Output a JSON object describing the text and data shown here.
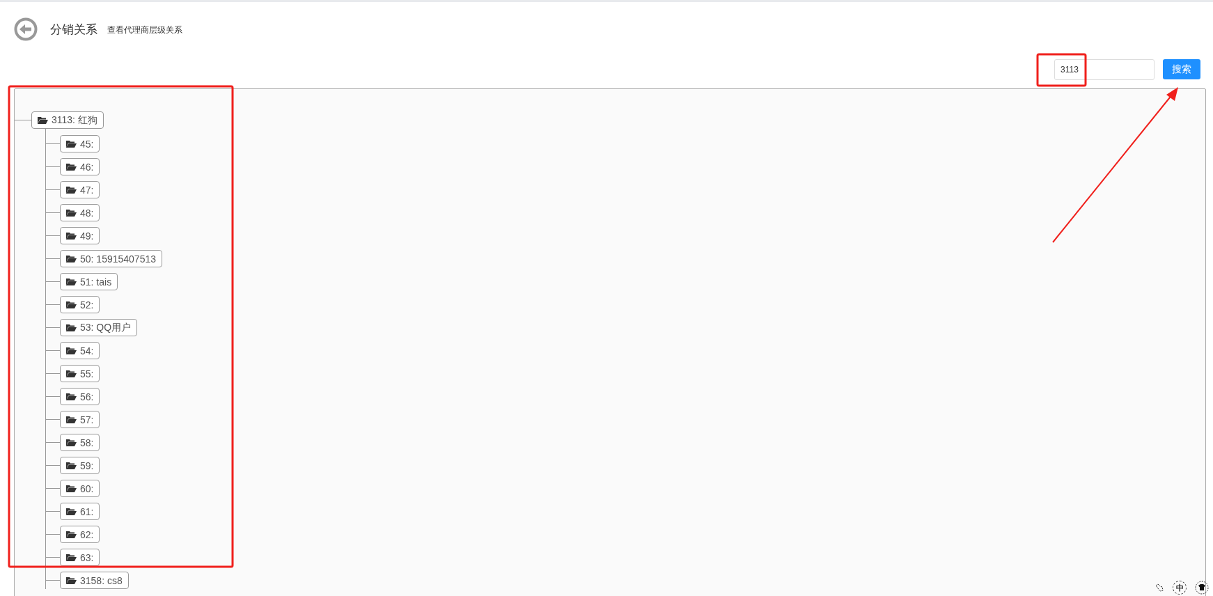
{
  "header": {
    "title": "分销关系",
    "subtitle": "查看代理商层级关系"
  },
  "search": {
    "value": "3113",
    "button": "搜索"
  },
  "tree": [
    {
      "label": "3113: 红狗",
      "children": [
        {
          "label": "45:"
        },
        {
          "label": "46:"
        },
        {
          "label": "47:"
        },
        {
          "label": "48:"
        },
        {
          "label": "49:"
        },
        {
          "label": "50: 15915407513"
        },
        {
          "label": "51: tais"
        },
        {
          "label": "52:"
        },
        {
          "label": "53: QQ用户"
        },
        {
          "label": "54:"
        },
        {
          "label": "55:"
        },
        {
          "label": "56:"
        },
        {
          "label": "57:"
        },
        {
          "label": "58:"
        },
        {
          "label": "59:"
        },
        {
          "label": "60:"
        },
        {
          "label": "61:"
        },
        {
          "label": "62:"
        },
        {
          "label": "63:"
        },
        {
          "label": "3158: cs8"
        }
      ]
    }
  ],
  "ime_toolbar": {
    "label": "中"
  }
}
